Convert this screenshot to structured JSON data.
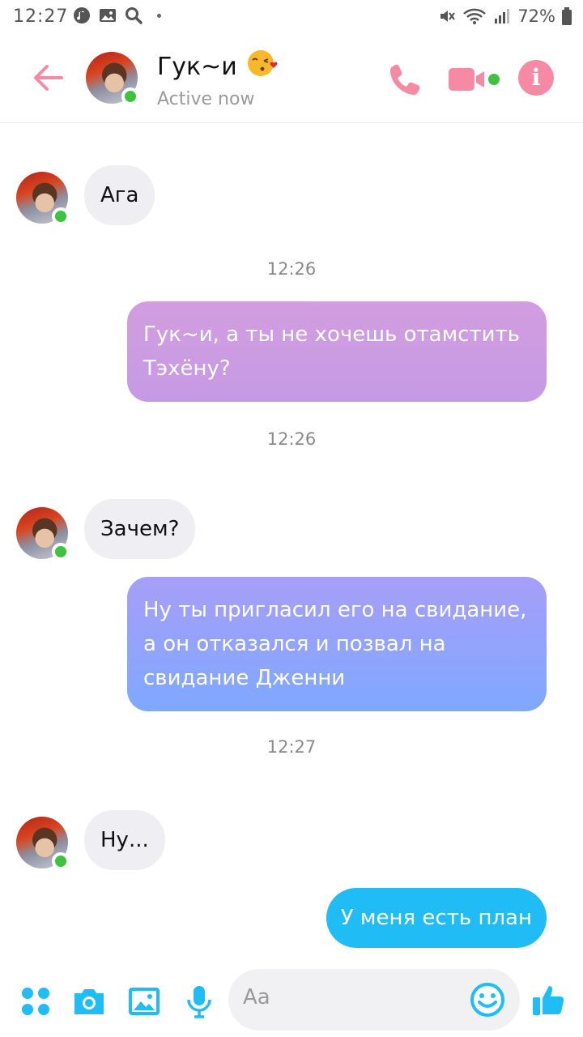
{
  "status_bar": {
    "time": "12:27",
    "battery": "72%",
    "icons": [
      "music-icon",
      "gallery-icon",
      "search-icon",
      "mute-icon",
      "wifi-icon",
      "signal-icon",
      "battery-icon"
    ]
  },
  "header": {
    "contact_name": "Гук~и",
    "contact_status": "Active now",
    "icons": [
      "back-arrow-icon",
      "phone-icon",
      "video-camera-icon",
      "info-icon"
    ]
  },
  "conversation": {
    "items": [
      {
        "type": "incoming",
        "text": "Ага"
      },
      {
        "type": "timestamp",
        "text": "12:26"
      },
      {
        "type": "outgoing",
        "text": "Гук~и, а ты не хочешь отамстить Тэхёну?"
      },
      {
        "type": "timestamp",
        "text": "12:26"
      },
      {
        "type": "incoming",
        "text": "Зачем?"
      },
      {
        "type": "outgoing",
        "text": "Ну ты пригласил его на свидание, а он отказался и позвал на свидание Дженни"
      },
      {
        "type": "timestamp",
        "text": "12:27"
      },
      {
        "type": "incoming",
        "text": "Ну..."
      },
      {
        "type": "outgoing",
        "text": "У меня есть план"
      }
    ]
  },
  "composer": {
    "placeholder": "Aa",
    "icons": [
      "apps-icon",
      "camera-icon",
      "image-icon",
      "microphone-icon",
      "emoji-icon",
      "thumbs-up-icon"
    ]
  },
  "colors": {
    "accent_pink": "#f68aa5",
    "accent_blue": "#1fbcf5",
    "online_green": "#3fc33f",
    "bubble_incoming": "#efeef2",
    "bubble_outgoing_gradient_top": "#d39ddf",
    "bubble_outgoing_gradient_bottom": "#6ea8ff"
  }
}
